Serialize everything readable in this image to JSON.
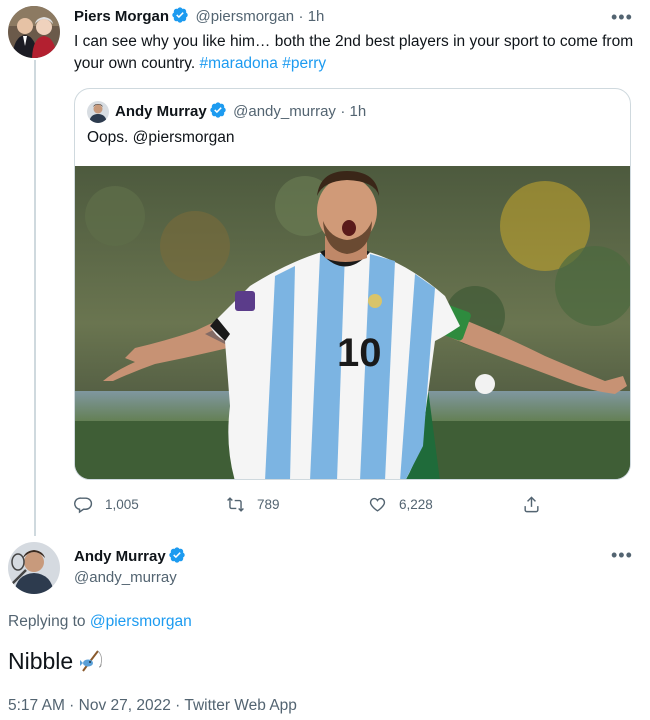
{
  "tweet1": {
    "author_name": "Piers Morgan",
    "author_handle": "@piersmorgan",
    "time": "· 1h",
    "text_main": "I can see why you like him… both the 2nd best players in your sport to come from your own country. ",
    "hashtag1": "#maradona",
    "hashtag2": "#perry",
    "more_icon": "•••",
    "quote": {
      "author_name": "Andy Murray",
      "author_handle": "@andy_murray",
      "time": "· 1h",
      "text": "Oops. @piersmorgan",
      "media_jersey_number": "10"
    },
    "actions": {
      "replies": "1,005",
      "retweets": "789",
      "likes": "6,228"
    }
  },
  "tweet2": {
    "author_name": "Andy Murray",
    "author_handle": "@andy_murray",
    "more_icon": "•••",
    "replying_prefix": "Replying to ",
    "replying_to": "@piersmorgan",
    "text": "Nibble",
    "meta": "5:17 AM · Nov 27, 2022 · Twitter Web App"
  },
  "colors": {
    "accent": "#1d9bf0",
    "secondary_text": "#536471",
    "border": "#cfd9de"
  },
  "icons": [
    "verified-badge-icon",
    "more-icon",
    "reply-icon",
    "retweet-icon",
    "like-icon",
    "share-icon",
    "fishing-pole-emoji-icon"
  ]
}
